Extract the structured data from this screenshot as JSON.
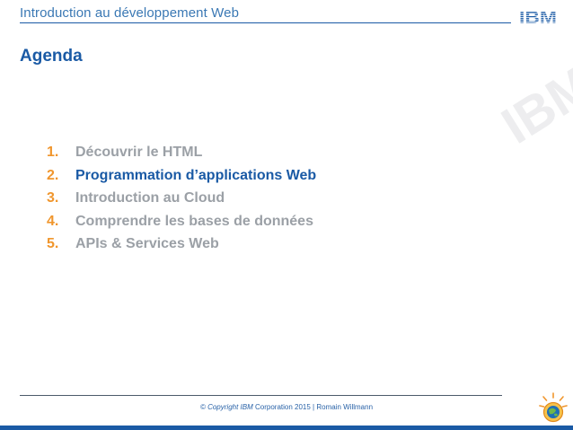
{
  "header": {
    "title": "Introduction au développement Web",
    "logo_text": "IBM"
  },
  "agenda": {
    "title": "Agenda",
    "items": [
      {
        "number": "1.",
        "label": "Découvrir le HTML",
        "active": false
      },
      {
        "number": "2.",
        "label": "Programmation d’applications Web",
        "active": true
      },
      {
        "number": "3.",
        "label": "Introduction au Cloud",
        "active": false
      },
      {
        "number": "4.",
        "label": "Comprendre les bases de données",
        "active": false
      },
      {
        "number": "5.",
        "label": "APIs & Services Web",
        "active": false
      }
    ]
  },
  "footer": {
    "copyright_prefix": "© Copyright IBM",
    "copyright_suffix": "Corporation 2015 | Romain Willmann"
  },
  "colors": {
    "brand_blue": "#1a5aa5",
    "number_orange": "#f0962d",
    "inactive_gray": "#9ba0a6"
  }
}
